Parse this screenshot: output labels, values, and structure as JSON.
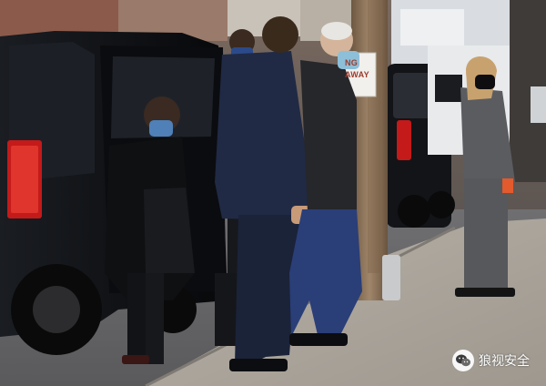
{
  "scene": {
    "description_tags": [
      "street",
      "black-suv",
      "people",
      "utility-pole",
      "sidewalk"
    ],
    "colors": {
      "suv": "#0d0f12",
      "suit_navy": "#202a45",
      "sidewalk": "#a9a49c",
      "pole": "#8a6f52",
      "taillight": "#c41a1a"
    }
  },
  "sign": {
    "line1": "NG",
    "line2": "AWAY"
  },
  "watermark": {
    "icon": "wechat-icon",
    "text": "狼视安全"
  }
}
